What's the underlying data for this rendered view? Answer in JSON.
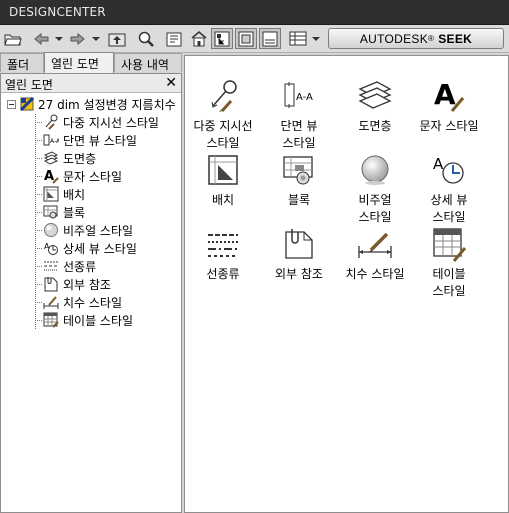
{
  "window": {
    "title": "DESIGNCENTER"
  },
  "toolbar": {
    "seek_brand": "AUTODESK",
    "seek_reg": "®",
    "seek_word": "SEEK"
  },
  "tabs": [
    "폴더",
    "열린 도면",
    "사용 내역"
  ],
  "left_panel": {
    "header": "열린 도면",
    "close": "✕",
    "root_label": "27 dim 설정변경 지름치수",
    "items": [
      {
        "label": "다중 지시선 스타일",
        "icon": "multileader-style-icon"
      },
      {
        "label": "단면 뷰 스타일",
        "icon": "section-view-style-icon"
      },
      {
        "label": "도면층",
        "icon": "layers-icon"
      },
      {
        "label": "문자 스타일",
        "icon": "text-style-icon"
      },
      {
        "label": "배치",
        "icon": "layout-icon"
      },
      {
        "label": "블록",
        "icon": "block-icon"
      },
      {
        "label": "비주얼 스타일",
        "icon": "visual-style-icon"
      },
      {
        "label": "상세 뷰 스타일",
        "icon": "detail-view-style-icon"
      },
      {
        "label": "선종류",
        "icon": "linetype-icon"
      },
      {
        "label": "외부 참조",
        "icon": "xref-icon"
      },
      {
        "label": "치수 스타일",
        "icon": "dimension-style-icon"
      },
      {
        "label": "테이블 스타일",
        "icon": "table-style-icon"
      }
    ]
  },
  "content": {
    "items": [
      {
        "line1": "다중 지시선",
        "line2": "스타일",
        "icon": "multileader-style-icon"
      },
      {
        "line1": "단면 뷰",
        "line2": "스타일",
        "icon": "section-view-style-icon"
      },
      {
        "line1": "도면층",
        "line2": "",
        "icon": "layers-icon"
      },
      {
        "line1": "문자 스타일",
        "line2": "",
        "icon": "text-style-icon"
      },
      {
        "line1": "배치",
        "line2": "",
        "icon": "layout-icon"
      },
      {
        "line1": "블록",
        "line2": "",
        "icon": "block-icon"
      },
      {
        "line1": "비주얼",
        "line2": "스타일",
        "icon": "visual-style-icon"
      },
      {
        "line1": "상세 뷰",
        "line2": "스타일",
        "icon": "detail-view-style-icon"
      },
      {
        "line1": "선종류",
        "line2": "",
        "icon": "linetype-icon"
      },
      {
        "line1": "외부 참조",
        "line2": "",
        "icon": "xref-icon"
      },
      {
        "line1": "치수 스타일",
        "line2": "",
        "icon": "dimension-style-icon"
      },
      {
        "line1": "테이블",
        "line2": "스타일",
        "icon": "table-style-icon"
      }
    ]
  }
}
